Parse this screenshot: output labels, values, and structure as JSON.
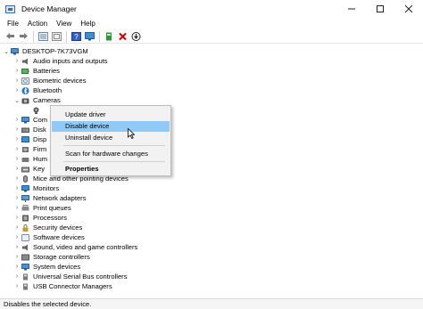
{
  "window": {
    "title": "Device Manager"
  },
  "menu": {
    "file": "File",
    "action": "Action",
    "view": "View",
    "help": "Help"
  },
  "toolbar": {
    "icons": [
      "back-arrow-icon",
      "forward-arrow-icon",
      "properties-icon",
      "help-icon",
      "monitor-icon",
      "update-driver-icon",
      "uninstall-icon",
      "download-icon"
    ],
    "colors": {
      "accent": "#3a6ea5",
      "uninstall": "#d40000",
      "highlight": "#91c9f7"
    }
  },
  "tree": {
    "root": "DESKTOP-7K73VGM",
    "categories": [
      {
        "label": "Audio inputs and outputs",
        "icon": "speaker-icon"
      },
      {
        "label": "Batteries",
        "icon": "battery-icon"
      },
      {
        "label": "Biometric devices",
        "icon": "fingerprint-icon"
      },
      {
        "label": "Bluetooth",
        "icon": "bluetooth-icon"
      },
      {
        "label": "Cameras",
        "icon": "camera-icon",
        "expanded": true
      },
      {
        "label": "",
        "icon": "webcam-icon",
        "child": true
      },
      {
        "label": "Com",
        "icon": "computer-icon"
      },
      {
        "label": "Disk",
        "icon": "disk-drive-icon"
      },
      {
        "label": "Disp",
        "icon": "display-adapter-icon"
      },
      {
        "label": "Firm",
        "icon": "firmware-icon"
      },
      {
        "label": "Hum",
        "icon": "hid-icon"
      },
      {
        "label": "Key",
        "icon": "keyboard-icon"
      },
      {
        "label": "Mice and other pointing devices",
        "icon": "mouse-icon"
      },
      {
        "label": "Monitors",
        "icon": "monitor-icon"
      },
      {
        "label": "Network adapters",
        "icon": "network-icon"
      },
      {
        "label": "Print queues",
        "icon": "printer-icon"
      },
      {
        "label": "Processors",
        "icon": "processor-icon"
      },
      {
        "label": "Security devices",
        "icon": "security-icon"
      },
      {
        "label": "Software devices",
        "icon": "software-icon"
      },
      {
        "label": "Sound, video and game controllers",
        "icon": "sound-icon"
      },
      {
        "label": "Storage controllers",
        "icon": "storage-icon"
      },
      {
        "label": "System devices",
        "icon": "system-icon"
      },
      {
        "label": "Universal Serial Bus controllers",
        "icon": "usb-icon"
      },
      {
        "label": "USB Connector Managers",
        "icon": "usb-icon"
      }
    ]
  },
  "context_menu": {
    "update": "Update driver",
    "disable": "Disable device",
    "uninstall": "Uninstall device",
    "scan": "Scan for hardware changes",
    "properties": "Properties"
  },
  "status": {
    "text": "Disables the selected device."
  }
}
